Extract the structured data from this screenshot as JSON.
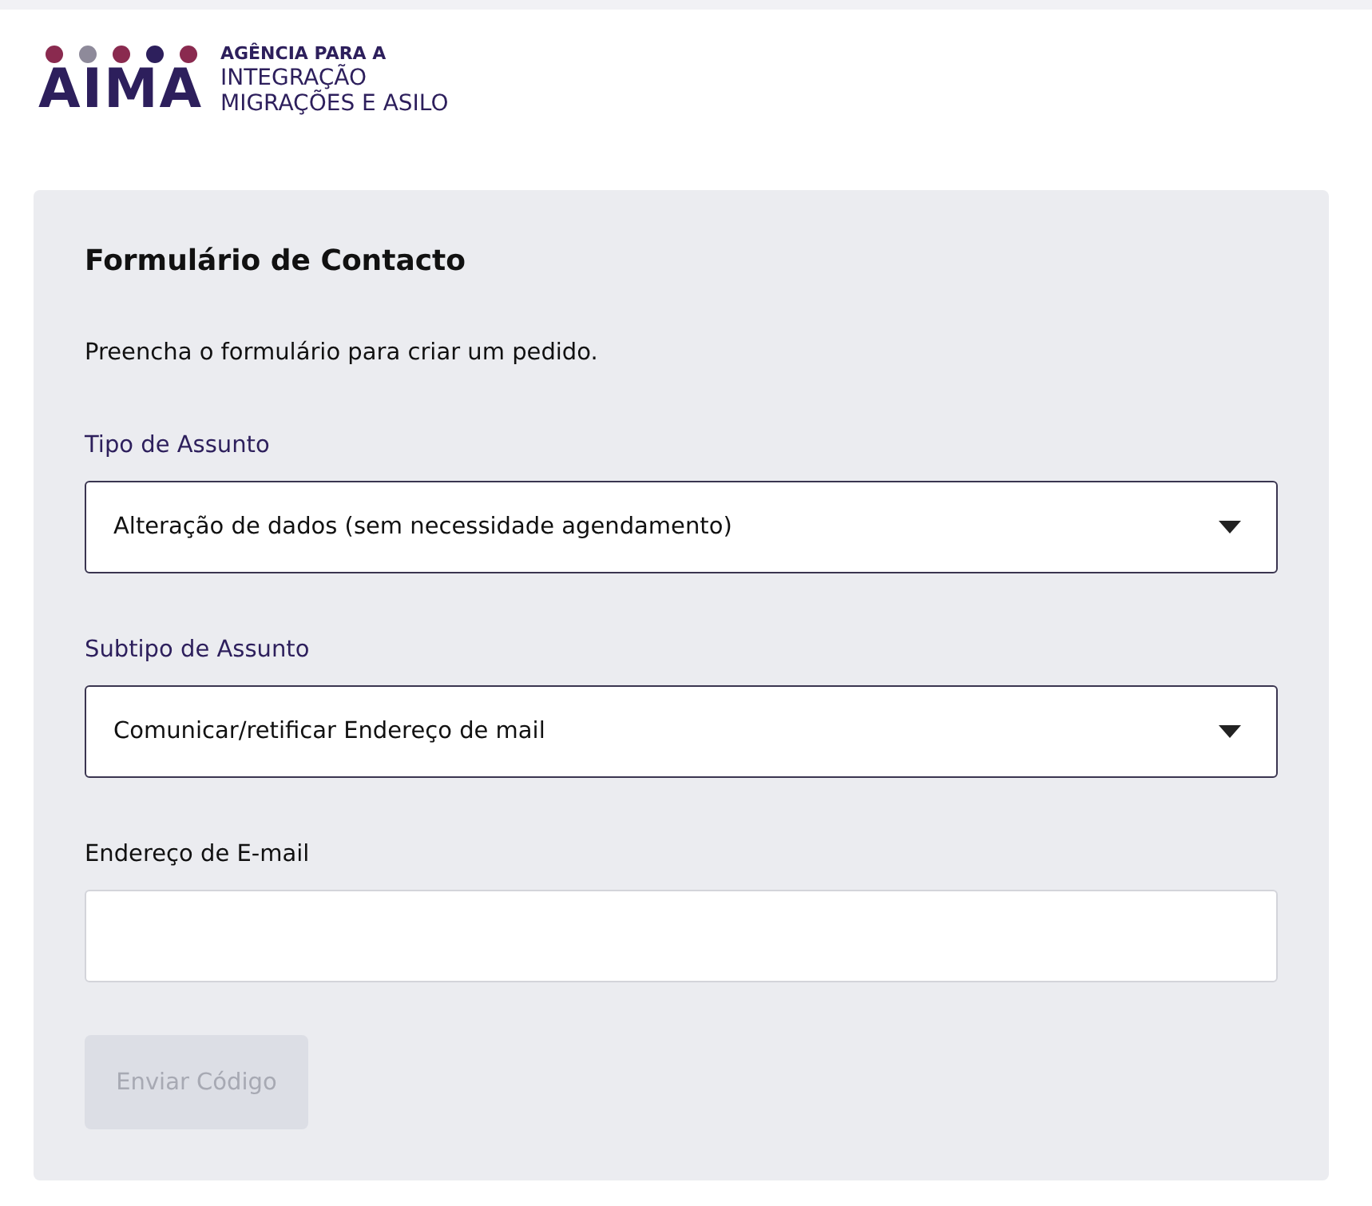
{
  "logo": {
    "wordmark": "AIMA",
    "lines": [
      "AGÊNCIA PARA A",
      "INTEGRAÇÃO",
      "MIGRAÇÕES E ASILO"
    ],
    "dots": [
      {
        "color": "#8a2a4f"
      },
      {
        "color": "#8e8a9a"
      },
      {
        "color": "#8a2a4f"
      },
      {
        "color": "#2d1f5c"
      },
      {
        "color": "#8a2a4f"
      }
    ]
  },
  "form": {
    "title": "Formulário de Contacto",
    "description": "Preencha o formulário para criar um pedido.",
    "fields": [
      {
        "kind": "select",
        "label": "Tipo de Assunto",
        "value": "Alteração de dados (sem necessidade agendamento)"
      },
      {
        "kind": "select",
        "label": "Subtipo de Assunto",
        "value": "Comunicar/retificar Endereço de mail"
      },
      {
        "kind": "input",
        "label": "Endereço de E-mail"
      }
    ],
    "button": {
      "label": "Enviar Código",
      "disabled": true
    }
  }
}
